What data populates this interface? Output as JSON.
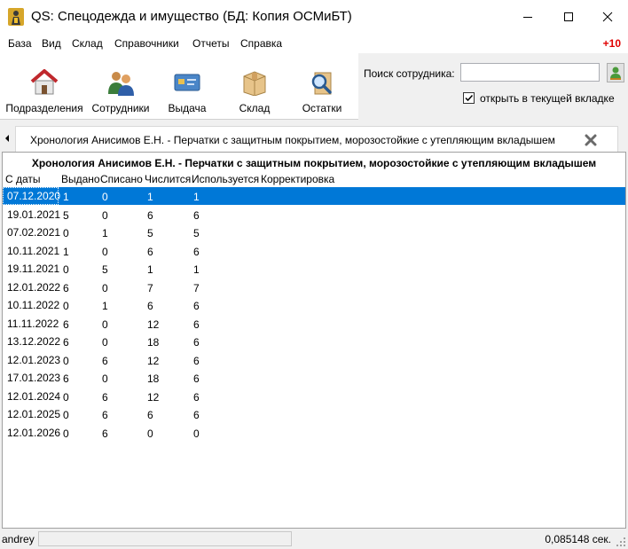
{
  "window": {
    "title": "QS: Спецодежда и имущество (БД: Копия ОСМиБТ)"
  },
  "menu": {
    "items": [
      "База",
      "Вид",
      "Склад",
      "Справочники",
      "Отчеты",
      "Справка"
    ],
    "counter": "+10"
  },
  "toolbar": {
    "buttons": [
      {
        "label": "Подразделения",
        "icon": "house-icon"
      },
      {
        "label": "Сотрудники",
        "icon": "people-icon"
      },
      {
        "label": "Выдача",
        "icon": "card-icon"
      },
      {
        "label": "Склад",
        "icon": "box-icon"
      },
      {
        "label": "Остатки",
        "icon": "magnifier-icon"
      }
    ],
    "search_label": "Поиск сотрудника:",
    "search_value": "",
    "open_in_tab_label": "открыть в текущей вкладке",
    "open_in_tab_checked": true
  },
  "tab": {
    "title": "Хронология Анисимов Е.Н. - Перчатки с защитным покрытием, морозостойкие с утепляющим вкладышем"
  },
  "grid": {
    "title": "Хронология Анисимов Е.Н. - Перчатки с защитным покрытием, морозостойкие с утепляющим вкладышем",
    "columns": [
      "С даты",
      "Выдано",
      "Списано",
      "Числится",
      "Используется",
      "Корректировка"
    ],
    "selected_row": 0,
    "rows": [
      [
        "07.12.2020",
        "1",
        "0",
        "1",
        "1"
      ],
      [
        "19.01.2021",
        "5",
        "0",
        "6",
        "6"
      ],
      [
        "07.02.2021",
        "0",
        "1",
        "5",
        "5"
      ],
      [
        "10.11.2021",
        "1",
        "0",
        "6",
        "6"
      ],
      [
        "19.11.2021",
        "0",
        "5",
        "1",
        "1"
      ],
      [
        "12.01.2022",
        "6",
        "0",
        "7",
        "7"
      ],
      [
        "10.11.2022",
        "0",
        "1",
        "6",
        "6"
      ],
      [
        "11.11.2022",
        "6",
        "0",
        "12",
        "6"
      ],
      [
        "13.12.2022",
        "6",
        "0",
        "18",
        "6"
      ],
      [
        "12.01.2023",
        "0",
        "6",
        "12",
        "6"
      ],
      [
        "17.01.2023",
        "6",
        "0",
        "18",
        "6"
      ],
      [
        "12.01.2024",
        "0",
        "6",
        "12",
        "6"
      ],
      [
        "12.01.2025",
        "0",
        "6",
        "6",
        "6"
      ],
      [
        "12.01.2026",
        "0",
        "6",
        "0",
        "0"
      ]
    ]
  },
  "status": {
    "user": "andrey",
    "time": "0,085148 сек."
  }
}
